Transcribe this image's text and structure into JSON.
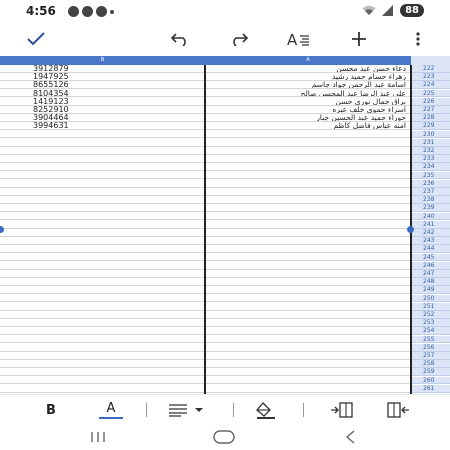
{
  "status_bar": {
    "time": "4:56",
    "battery": "88"
  },
  "toolbar": {
    "confirm_icon": "check-icon",
    "undo_icon": "undo-icon",
    "redo_icon": "redo-icon",
    "text_format_icon": "text-format-icon",
    "add_icon": "plus-icon",
    "more_icon": "more-vertical-icon"
  },
  "columns": {
    "b": "B",
    "a": "A"
  },
  "rows": [
    {
      "num": "222",
      "b": "3912879",
      "a": "دعاء حسن عبد محسن"
    },
    {
      "num": "223",
      "b": "1947925",
      "a": "زهراء حسام حميد رشيد"
    },
    {
      "num": "224",
      "b": "8655126",
      "a": "اسامة عبد الرحمن جواد جاسم"
    },
    {
      "num": "225",
      "b": "8104354",
      "a": "علي عبد الرضا عبد المحسن صالح"
    },
    {
      "num": "226",
      "b": "1419123",
      "a": "براق جمال نوري حسن"
    },
    {
      "num": "227",
      "b": "8252910",
      "a": "اسراء حموي خلف عبره"
    },
    {
      "num": "228",
      "b": "3904464",
      "a": "حوراء حميد عبد الحسين جبار"
    },
    {
      "num": "229",
      "b": "3994631",
      "a": "امنه عباس فاضل كاظم"
    },
    {
      "num": "230",
      "b": "",
      "a": ""
    },
    {
      "num": "231",
      "b": "",
      "a": ""
    },
    {
      "num": "232",
      "b": "",
      "a": ""
    },
    {
      "num": "233",
      "b": "",
      "a": ""
    },
    {
      "num": "234",
      "b": "",
      "a": ""
    },
    {
      "num": "235",
      "b": "",
      "a": ""
    },
    {
      "num": "236",
      "b": "",
      "a": ""
    },
    {
      "num": "237",
      "b": "",
      "a": ""
    },
    {
      "num": "238",
      "b": "",
      "a": ""
    },
    {
      "num": "239",
      "b": "",
      "a": ""
    },
    {
      "num": "240",
      "b": "",
      "a": ""
    },
    {
      "num": "241",
      "b": "",
      "a": ""
    },
    {
      "num": "242",
      "b": "",
      "a": ""
    },
    {
      "num": "243",
      "b": "",
      "a": ""
    },
    {
      "num": "244",
      "b": "",
      "a": ""
    },
    {
      "num": "245",
      "b": "",
      "a": ""
    },
    {
      "num": "246",
      "b": "",
      "a": ""
    },
    {
      "num": "247",
      "b": "",
      "a": ""
    },
    {
      "num": "248",
      "b": "",
      "a": ""
    },
    {
      "num": "249",
      "b": "",
      "a": ""
    },
    {
      "num": "250",
      "b": "",
      "a": ""
    },
    {
      "num": "251",
      "b": "",
      "a": ""
    },
    {
      "num": "252",
      "b": "",
      "a": ""
    },
    {
      "num": "253",
      "b": "",
      "a": ""
    },
    {
      "num": "254",
      "b": "",
      "a": ""
    },
    {
      "num": "255",
      "b": "",
      "a": ""
    },
    {
      "num": "256",
      "b": "",
      "a": ""
    },
    {
      "num": "257",
      "b": "",
      "a": ""
    },
    {
      "num": "258",
      "b": "",
      "a": ""
    },
    {
      "num": "259",
      "b": "",
      "a": ""
    },
    {
      "num": "260",
      "b": "",
      "a": ""
    },
    {
      "num": "261",
      "b": "",
      "a": ""
    }
  ],
  "format_bar": {
    "bold_label": "B",
    "text_color_label": "A",
    "text_color_accent": "#3a6bc7"
  },
  "colors": {
    "accent": "#4a77c8",
    "row_header_bg": "#dbe5f6"
  }
}
